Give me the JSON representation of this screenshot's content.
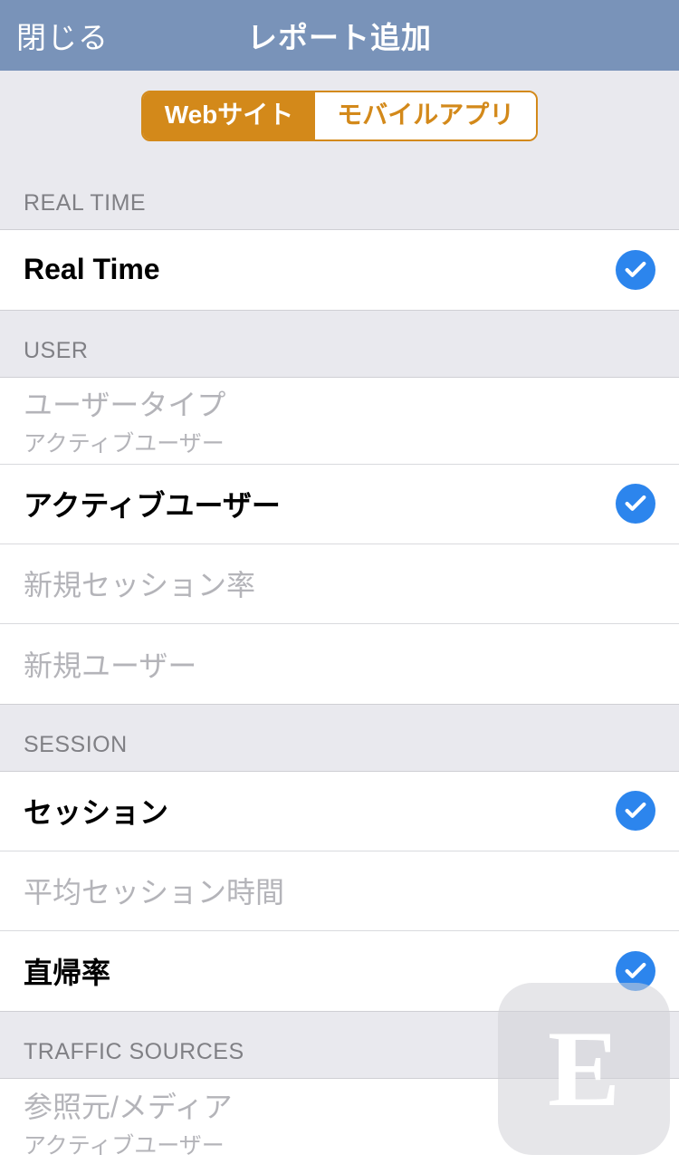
{
  "navbar": {
    "close": "閉じる",
    "title": "レポート追加"
  },
  "segmented": {
    "active": "Webサイト",
    "inactive": "モバイルアプリ"
  },
  "sections": [
    {
      "header": "REAL TIME",
      "rows": [
        {
          "label": "Real Time",
          "checked": true,
          "disabled": false
        }
      ]
    },
    {
      "header": "USER",
      "rows": [
        {
          "label": "ユーザータイプ",
          "sub": "アクティブユーザー",
          "checked": false,
          "disabled": true
        },
        {
          "label": "アクティブユーザー",
          "checked": true,
          "disabled": false
        },
        {
          "label": "新規セッション率",
          "checked": false,
          "disabled": true
        },
        {
          "label": "新規ユーザー",
          "checked": false,
          "disabled": true
        }
      ]
    },
    {
      "header": "SESSION",
      "rows": [
        {
          "label": "セッション",
          "checked": true,
          "disabled": false
        },
        {
          "label": "平均セッション時間",
          "checked": false,
          "disabled": true
        },
        {
          "label": "直帰率",
          "checked": true,
          "disabled": false
        }
      ]
    },
    {
      "header": "TRAFFIC SOURCES",
      "rows": [
        {
          "label": "参照元/メディア",
          "sub": "アクティブユーザー",
          "checked": false,
          "disabled": true
        }
      ]
    }
  ],
  "fab": {
    "glyph": "E"
  }
}
